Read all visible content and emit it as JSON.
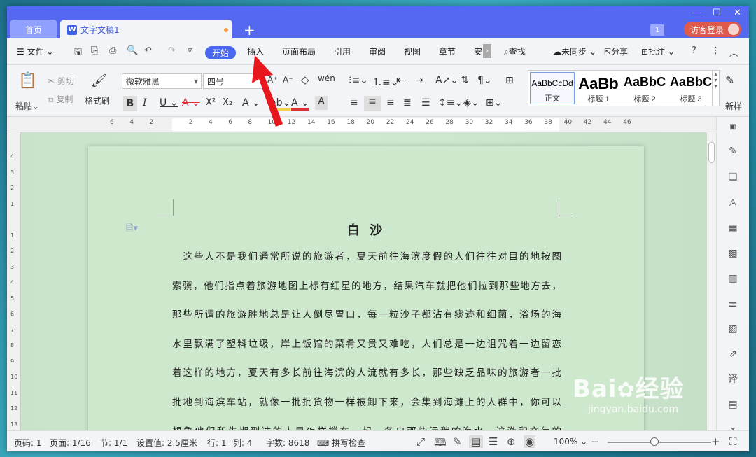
{
  "tabs": {
    "home": "首页",
    "doc": "文字文稿1"
  },
  "titlebar": {
    "badge": "1",
    "login": "访客登录"
  },
  "menu": {
    "file": "文件",
    "items": [
      "开始",
      "插入",
      "页面布局",
      "引用",
      "审阅",
      "视图",
      "章节",
      "安"
    ],
    "search": "查找",
    "sync": "未同步",
    "share": "分享",
    "comment": "批注"
  },
  "ribbon": {
    "paste": "粘贴",
    "cut": "剪切",
    "copy": "复制",
    "format_painter": "格式刷",
    "font_name": "微软雅黑",
    "font_size": "四号",
    "styles": [
      {
        "preview": "AaBbCcDd",
        "label": "正文"
      },
      {
        "preview": "AaBb",
        "label": "标题 1"
      },
      {
        "preview": "AaBbC",
        "label": "标题 2"
      },
      {
        "preview": "AaBbC",
        "label": "标题 3"
      }
    ],
    "new_style": "新样"
  },
  "ruler": {
    "ticks": [
      "6",
      "4",
      "2",
      "",
      "2",
      "4",
      "6",
      "8",
      "10",
      "12",
      "14",
      "16",
      "18",
      "20",
      "22",
      "24",
      "26",
      "28",
      "30",
      "32",
      "34",
      "36",
      "38",
      "40",
      "42",
      "44",
      "46"
    ]
  },
  "vruler": {
    "ticks": [
      "4",
      "3",
      "2",
      "1",
      "",
      "1",
      "2",
      "3",
      "4",
      "5",
      "6",
      "7",
      "8",
      "9",
      "10",
      "11",
      "12",
      "13"
    ]
  },
  "document": {
    "title": "白 沙",
    "lines": [
      "　这些人不是我们通常所说的旅游者，夏天前往海滨度假的人们往往对目的地按图",
      "索骥，他们指点着旅游地图上标有红星的地方，结果汽车就把他们拉到那些地方去，",
      "那些所谓的旅游胜地总是让人倒尽胃口，每一粒沙子都沾有痰迹和细菌，浴场的海",
      "水里飘满了塑料垃圾，岸上饭馆的菜肴又贵又难吃，人们总是一边诅咒着一边留恋",
      "着这样的地方，夏天有多长前往海滨的人流就有多长，那些缺乏品味的旅游者一批",
      "批地到海滨车站，就像一批批货物一样被卸下来，会集到海滩上的人群中，你可以",
      "想象他们和先期到达的人是怎样搅在一起，各自那些污秽的海水，这游和交气的"
    ]
  },
  "status": {
    "page_code": "页码: 1",
    "page": "页面: 1/16",
    "section": "节: 1/1",
    "setting": "设置值: 2.5厘米",
    "row": "行: 1",
    "col": "列: 4",
    "words": "字数: 8618",
    "spell": "拼写检查",
    "zoom": "100%"
  },
  "watermark": {
    "brand": "Bai",
    "brand2": "经验",
    "url": "jingyan.baidu.com"
  }
}
